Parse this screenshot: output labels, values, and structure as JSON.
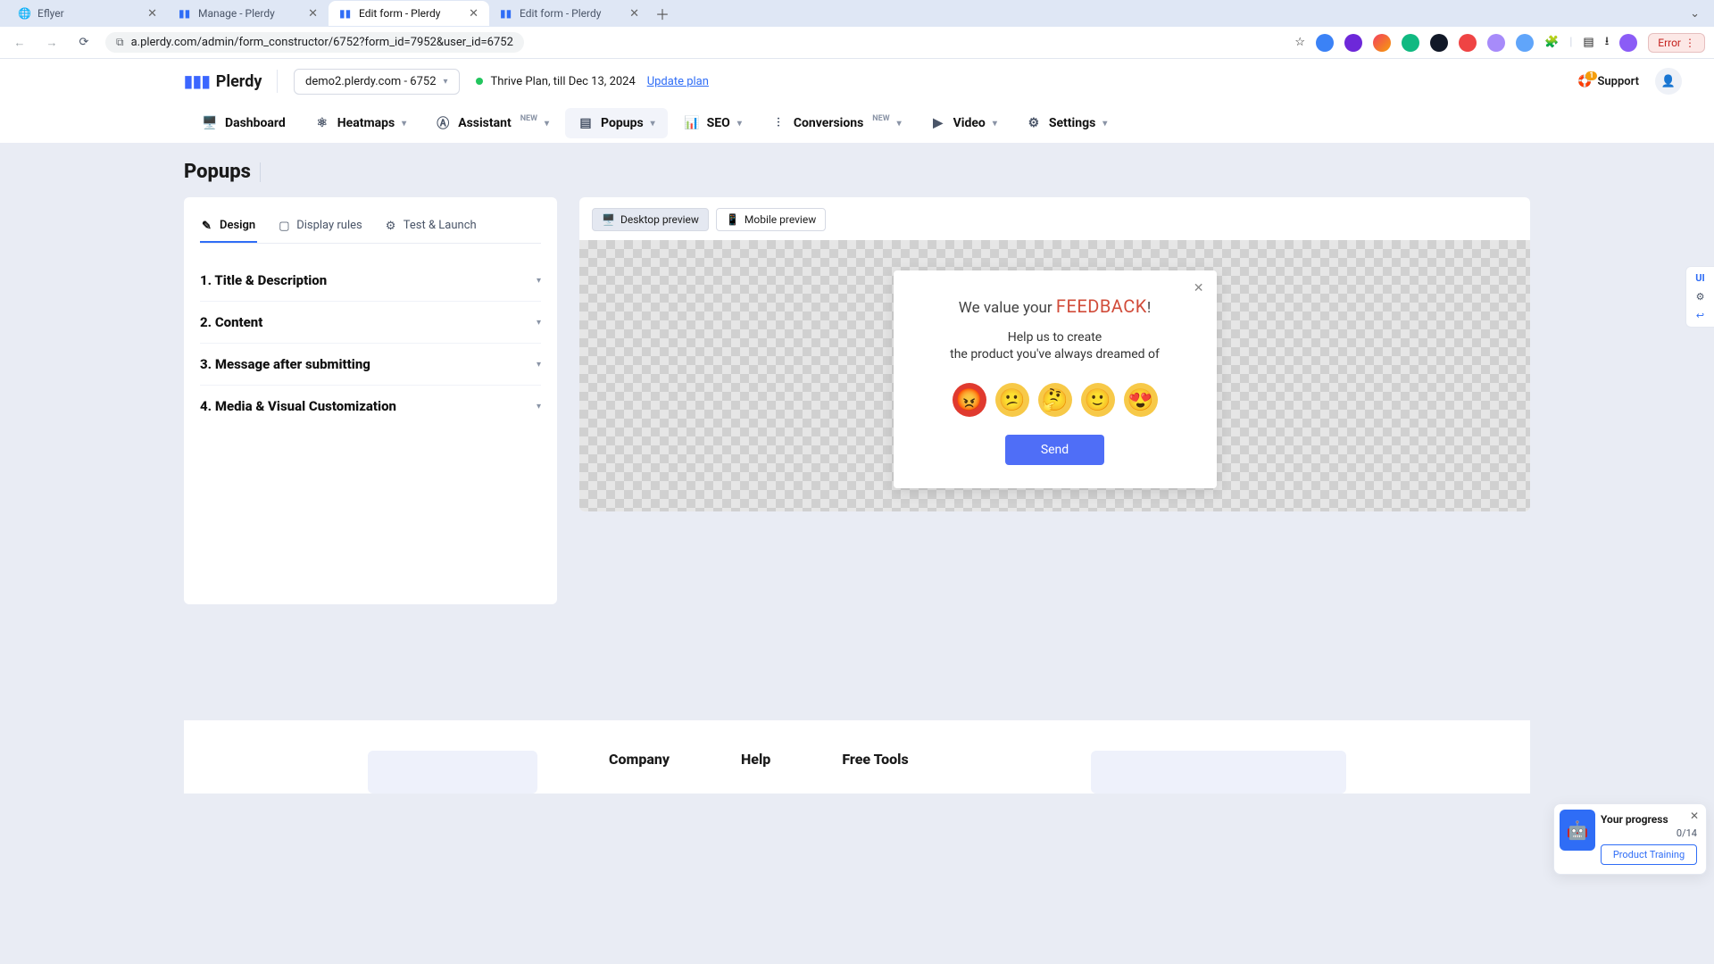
{
  "browser": {
    "tabs": [
      {
        "title": "Eflyer",
        "active": false
      },
      {
        "title": "Manage - Plerdy",
        "active": false
      },
      {
        "title": "Edit form - Plerdy",
        "active": true
      },
      {
        "title": "Edit form - Plerdy",
        "active": false
      }
    ],
    "url": "a.plerdy.com/admin/form_constructor/6752?form_id=7952&user_id=6752",
    "error_label": "Error"
  },
  "top": {
    "brand": "Plerdy",
    "site_select": "demo2.plerdy.com - 6752",
    "plan_text": "Thrive Plan, till Dec 13, 2024",
    "update_link": "Update plan",
    "support": "Support",
    "support_badge": "1"
  },
  "nav": {
    "items": [
      {
        "label": "Dashboard",
        "icon": "monitor",
        "active": false,
        "new": false
      },
      {
        "label": "Heatmaps",
        "icon": "atoms",
        "active": false,
        "new": false
      },
      {
        "label": "Assistant",
        "icon": "ai",
        "active": false,
        "new": true
      },
      {
        "label": "Popups",
        "icon": "form",
        "active": true,
        "new": false
      },
      {
        "label": "SEO",
        "icon": "bars",
        "active": false,
        "new": false
      },
      {
        "label": "Conversions",
        "icon": "funnel",
        "active": false,
        "new": true
      },
      {
        "label": "Video",
        "icon": "play",
        "active": false,
        "new": false
      },
      {
        "label": "Settings",
        "icon": "gear",
        "active": false,
        "new": false
      }
    ]
  },
  "page": {
    "title": "Popups",
    "subtabs": [
      {
        "label": "Design",
        "active": true
      },
      {
        "label": "Display rules",
        "active": false
      },
      {
        "label": "Test & Launch",
        "active": false
      }
    ],
    "accordion": [
      "1. Title & Description",
      "2. Content",
      "3. Message after submitting",
      "4. Media & Visual Customization"
    ]
  },
  "preview": {
    "desktop_label": "Desktop preview",
    "mobile_label": "Mobile preview",
    "card": {
      "title_pre": "We value your ",
      "title_accent": "FEEDBACK",
      "title_post": "!",
      "line1": "Help us to create",
      "line2": "the product you've always dreamed of",
      "send": "Send",
      "emojis": [
        "😡",
        "😕",
        "🤔",
        "🙂",
        "😍"
      ]
    }
  },
  "floating": {
    "ui": "UI"
  },
  "progress": {
    "title": "Your progress",
    "count": "0/14",
    "button": "Product Training"
  },
  "footer": {
    "cols": [
      "Company",
      "Help",
      "Free Tools"
    ]
  },
  "colors": {
    "brand_blue": "#2f6df6",
    "accent_red": "#d14c3a"
  }
}
